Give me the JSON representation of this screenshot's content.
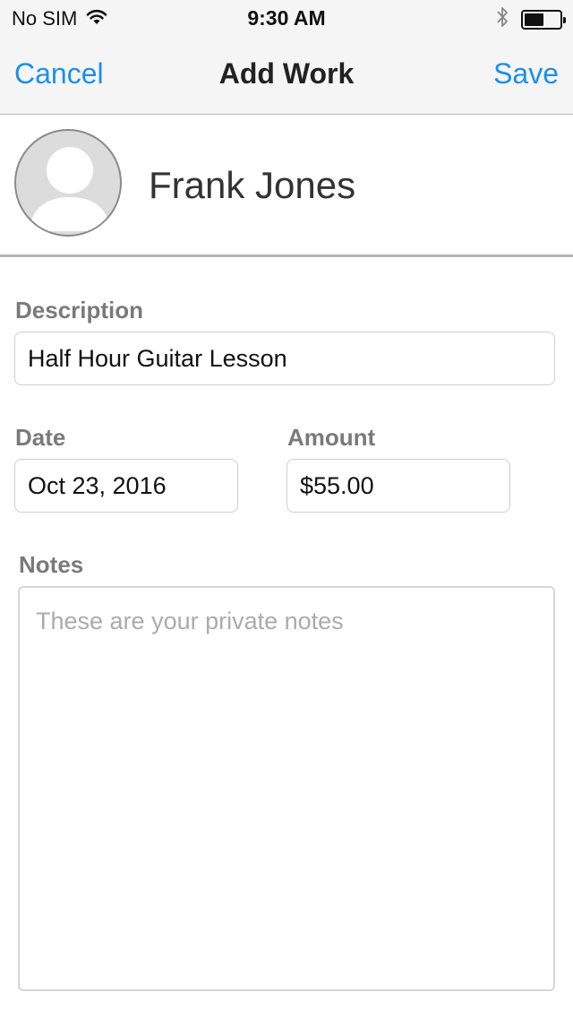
{
  "status_bar": {
    "carrier": "No SIM",
    "time": "9:30 AM",
    "icons": [
      "wifi-icon",
      "bluetooth-icon",
      "battery-icon"
    ],
    "battery_level": 0.55
  },
  "nav": {
    "cancel_label": "Cancel",
    "title": "Add Work",
    "save_label": "Save"
  },
  "client": {
    "name": "Frank Jones",
    "avatar_icon": "person-placeholder-icon"
  },
  "form": {
    "description": {
      "label": "Description",
      "value": "Half Hour Guitar Lesson"
    },
    "date": {
      "label": "Date",
      "value": "Oct 23, 2016"
    },
    "amount": {
      "label": "Amount",
      "value": "$55.00"
    },
    "notes": {
      "label": "Notes",
      "value": "",
      "placeholder": "These are your private notes"
    }
  },
  "colors": {
    "accent": "#1e8fe8",
    "label": "#7a7a7a",
    "bar_background": "#f5f5f5"
  }
}
